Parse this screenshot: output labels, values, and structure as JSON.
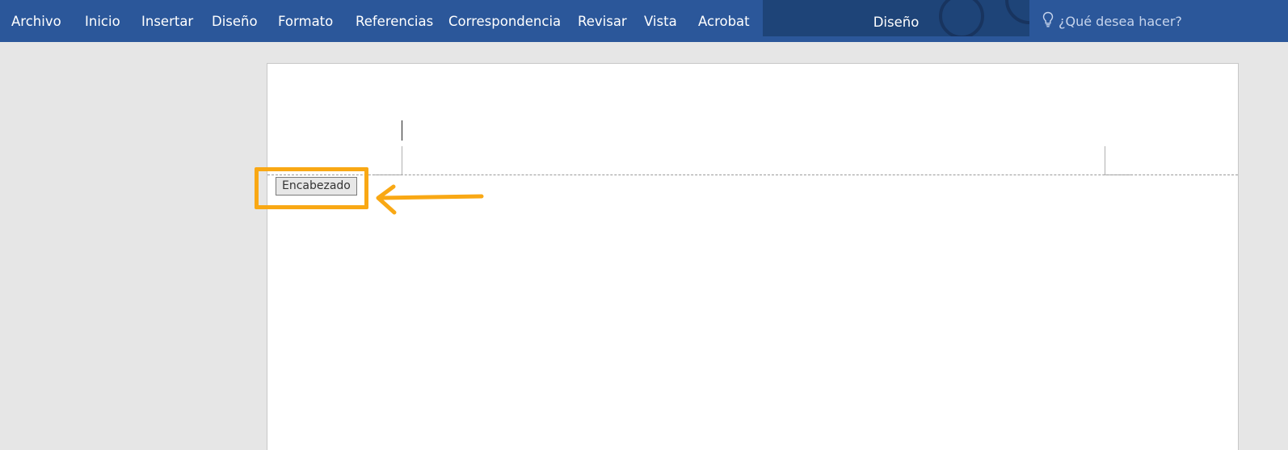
{
  "ribbon": {
    "tabs": [
      {
        "label": "Archivo"
      },
      {
        "label": "Inicio"
      },
      {
        "label": "Insertar"
      },
      {
        "label": "Diseño"
      },
      {
        "label": "Formato"
      },
      {
        "label": "Referencias"
      },
      {
        "label": "Correspondencia"
      },
      {
        "label": "Revisar"
      },
      {
        "label": "Vista"
      },
      {
        "label": "Acrobat"
      }
    ],
    "contextual_tab": "Diseño",
    "tell_me_placeholder": "¿Qué desea hacer?",
    "tell_me_icon": "lightbulb-icon"
  },
  "document": {
    "header_tag": "Encabezado"
  },
  "colors": {
    "ribbon": "#2b579a",
    "contextual_band": "#1e4478",
    "annotation": "#f9a814",
    "canvas": "#e6e6e6"
  }
}
